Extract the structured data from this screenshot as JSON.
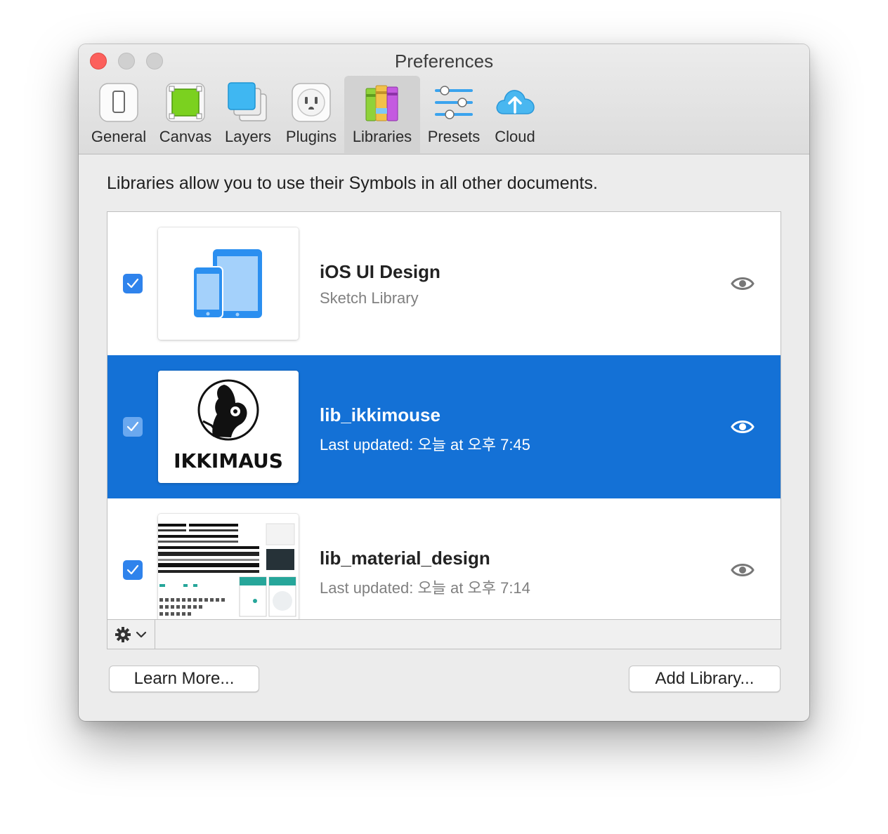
{
  "window": {
    "title": "Preferences"
  },
  "toolbar": {
    "items": [
      {
        "label": "General",
        "icon": "general-icon"
      },
      {
        "label": "Canvas",
        "icon": "canvas-icon"
      },
      {
        "label": "Layers",
        "icon": "layers-icon"
      },
      {
        "label": "Plugins",
        "icon": "plugins-icon"
      },
      {
        "label": "Libraries",
        "icon": "libraries-icon",
        "active": true
      },
      {
        "label": "Presets",
        "icon": "presets-icon"
      },
      {
        "label": "Cloud",
        "icon": "cloud-icon"
      }
    ]
  },
  "content": {
    "description": "Libraries allow you to use their Symbols in all other documents."
  },
  "libraries": [
    {
      "name": "iOS UI Design",
      "subtitle": "Sketch Library",
      "checked": true,
      "selected": false
    },
    {
      "name": "lib_ikkimouse",
      "subtitle": "Last updated: 오늘 at 오후 7:45",
      "checked": true,
      "selected": true,
      "thumb_text": "IKKIMAUS"
    },
    {
      "name": "lib_material_design",
      "subtitle": "Last updated: 오늘 at 오후 7:14",
      "checked": true,
      "selected": false
    }
  ],
  "buttons": {
    "learn_more": "Learn More...",
    "add_library": "Add Library..."
  },
  "colors": {
    "selection": "#1471d6",
    "checkbox": "#2f83ec",
    "close": "#fc605c",
    "ios_blue": "#2b8ff0"
  }
}
